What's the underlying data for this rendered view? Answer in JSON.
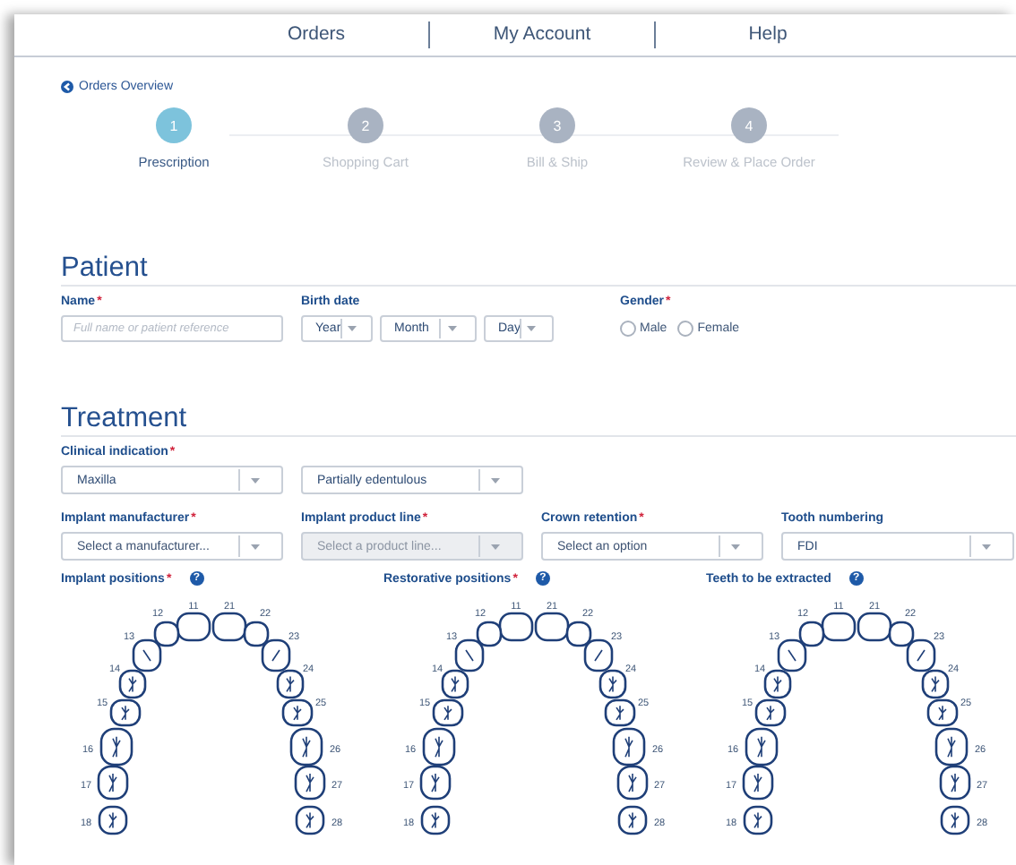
{
  "nav": {
    "items": [
      {
        "label": "Orders"
      },
      {
        "label": "My Account"
      },
      {
        "label": "Help"
      }
    ]
  },
  "back_link": {
    "label": "Orders Overview"
  },
  "stepper": {
    "steps": [
      {
        "number": "1",
        "label": "Prescription",
        "selected": true
      },
      {
        "number": "2",
        "label": "Shopping Cart",
        "selected": false
      },
      {
        "number": "3",
        "label": "Bill & Ship",
        "selected": false
      },
      {
        "number": "4",
        "label": "Review & Place Order",
        "selected": false
      }
    ]
  },
  "patient": {
    "heading": "Patient",
    "fields": [
      {
        "kind": "text",
        "label": "Name",
        "required_mark": "*",
        "placeholder": "Full name or patient reference"
      },
      {
        "kind": "date",
        "label": "Birth date",
        "selects": [
          {
            "value": "Year"
          },
          {
            "value": "Month"
          },
          {
            "value": "Day"
          }
        ]
      },
      {
        "kind": "radio",
        "label": "Gender",
        "required_mark": "*",
        "options": [
          {
            "label": "Male",
            "selected": false
          },
          {
            "label": "Female",
            "selected": false
          }
        ]
      }
    ]
  },
  "treatment": {
    "heading": "Treatment",
    "rows": [
      [
        {
          "label": "Clinical indication",
          "required_mark": "*",
          "value": "Maxilla",
          "disabled": false
        },
        {
          "value": "Partially edentulous",
          "disabled": false
        }
      ],
      [
        {
          "label": "Implant manufacturer",
          "required_mark": "*",
          "placeholder": "Select a manufacturer...",
          "disabled": false
        },
        {
          "label": "Implant product line",
          "required_mark": "*",
          "placeholder": "Select a product line...",
          "disabled": true
        },
        {
          "label": "Crown retention",
          "required_mark": "*",
          "placeholder": "Select an option",
          "disabled": false
        },
        {
          "label": "Tooth numbering",
          "value": "FDI",
          "disabled": false
        }
      ]
    ],
    "charts": [
      {
        "label": "Implant positions",
        "required_mark": "*",
        "help": "?",
        "teeth": [
          "11",
          "12",
          "13",
          "14",
          "15",
          "16",
          "17",
          "18",
          "21",
          "22",
          "23",
          "24",
          "25",
          "26",
          "27",
          "28"
        ]
      },
      {
        "label": "Restorative positions",
        "required_mark": "*",
        "help": "?",
        "teeth": [
          "11",
          "12",
          "13",
          "14",
          "15",
          "16",
          "17",
          "18",
          "21",
          "22",
          "23",
          "24",
          "25",
          "26",
          "27",
          "28"
        ]
      },
      {
        "label": "Teeth to be extracted",
        "help": "?",
        "teeth": [
          "11",
          "12",
          "13",
          "14",
          "15",
          "16",
          "17",
          "18",
          "21",
          "22",
          "23",
          "24",
          "25",
          "26",
          "27",
          "28"
        ]
      }
    ]
  }
}
